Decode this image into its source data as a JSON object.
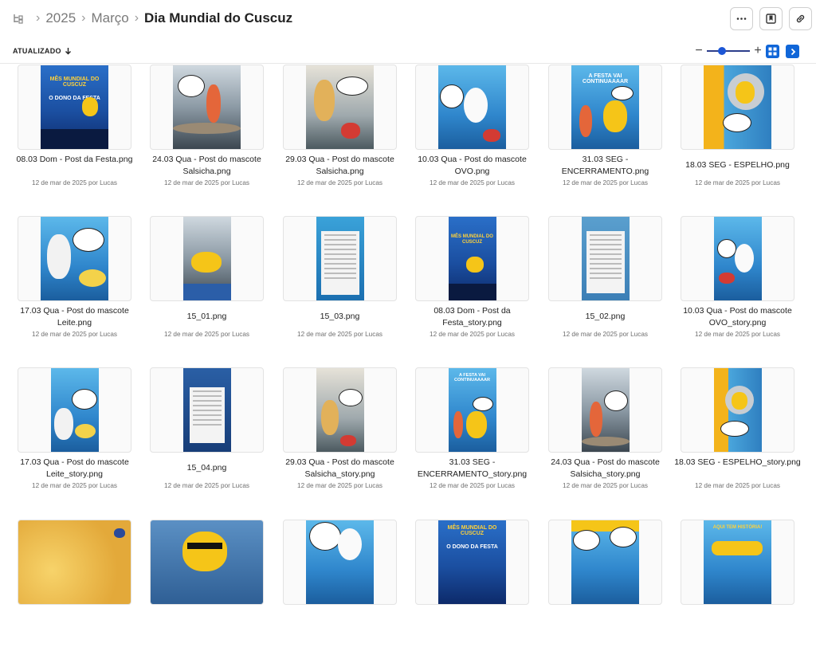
{
  "breadcrumb": {
    "items": [
      "2025",
      "Março"
    ],
    "current": "Dia Mundial do Cuscuz"
  },
  "toolbar": {
    "more_icon": "ellipsis-icon",
    "bookmark_icon": "bookmark-icon",
    "link_icon": "link-icon"
  },
  "sort": {
    "label": "ATUALIZADO",
    "direction_icon": "arrow-down-icon"
  },
  "zoom": {
    "level": 0.35
  },
  "colors": {
    "accent": "#1066d8",
    "slider": "#2c3e8c"
  },
  "files": [
    {
      "name": "08.03 Dom - Post da Festa.png",
      "meta": "12 de mar de 2025 por Lucas"
    },
    {
      "name": "24.03 Qua - Post do mascote Salsicha.png",
      "meta": "12 de mar de 2025 por Lucas"
    },
    {
      "name": "29.03 Qua - Post do mascote Salsicha.png",
      "meta": "12 de mar de 2025 por Lucas"
    },
    {
      "name": "10.03 Qua - Post do mascote OVO.png",
      "meta": "12 de mar de 2025 por Lucas"
    },
    {
      "name": "31.03 SEG - ENCERRAMENTO.png",
      "meta": "12 de mar de 2025 por Lucas"
    },
    {
      "name": "18.03 SEG - ESPELHO.png",
      "meta": "12 de mar de 2025 por Lucas"
    },
    {
      "name": "17.03 Qua - Post do mascote Leite.png",
      "meta": "12 de mar de 2025 por Lucas"
    },
    {
      "name": "15_01.png",
      "meta": "12 de mar de 2025 por Lucas"
    },
    {
      "name": "15_03.png",
      "meta": "12 de mar de 2025 por Lucas"
    },
    {
      "name": "08.03 Dom - Post da Festa_story.png",
      "meta": "12 de mar de 2025 por Lucas"
    },
    {
      "name": "15_02.png",
      "meta": "12 de mar de 2025 por Lucas"
    },
    {
      "name": "10.03 Qua - Post do mascote OVO_story.png",
      "meta": "12 de mar de 2025 por Lucas"
    },
    {
      "name": "17.03 Qua - Post do mascote Leite_story.png",
      "meta": "12 de mar de 2025 por Lucas"
    },
    {
      "name": "15_04.png",
      "meta": "12 de mar de 2025 por Lucas"
    },
    {
      "name": "29.03 Qua - Post do mascote Salsicha_story.png",
      "meta": "12 de mar de 2025 por Lucas"
    },
    {
      "name": "31.03 SEG - ENCERRAMENTO_story.png",
      "meta": "12 de mar de 2025 por Lucas"
    },
    {
      "name": "24.03 Qua - Post do mascote Salsicha_story.png",
      "meta": "12 de mar de 2025 por Lucas"
    },
    {
      "name": "18.03 SEG - ESPELHO_story.png",
      "meta": "12 de mar de 2025 por Lucas"
    }
  ],
  "poster_text": {
    "festa_title": "MÊS MUNDIAL DO CUSCUZ",
    "festa_sub": "O DONO DA FESTA",
    "encerramento_title": "A FESTA VAI CONTINUAAAAR",
    "historia": "AQUI TEM HISTÓRIA!"
  }
}
